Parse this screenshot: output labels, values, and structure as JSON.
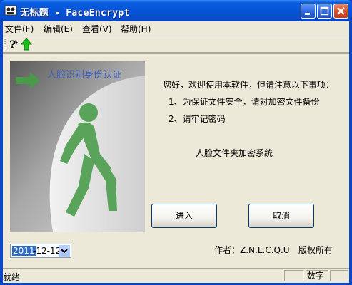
{
  "window": {
    "title": "无标题 - FaceEncrypt"
  },
  "menu": [
    "文件(F)",
    "编辑(E)",
    "查看(V)",
    "帮助(H)"
  ],
  "toolbar": {
    "tools": [
      "help-icon",
      "up-arrow-icon"
    ]
  },
  "banner": {
    "title": "人脸识别身份认证"
  },
  "notice": {
    "greeting": "您好，欢迎使用本软件，但请注意以下事项：",
    "item1": "1、为保证文件安全，请对加密文件备份",
    "item2": "2、请牢记密码",
    "system_name": "人脸文件夹加密系统"
  },
  "buttons": {
    "enter": "进入",
    "cancel": "取消"
  },
  "date": {
    "year": "2011",
    "rest": "-12-12"
  },
  "footer": {
    "author": "作者：Z.N.L.C.Q.U",
    "rights": "版权所有"
  },
  "status": {
    "text": "就绪",
    "numlock": "数字"
  },
  "colors": {
    "titlebar": "#0554d8",
    "walker_green": "#5aa35a",
    "banner_text": "#3e5fc0",
    "selection": "#316ac5"
  }
}
